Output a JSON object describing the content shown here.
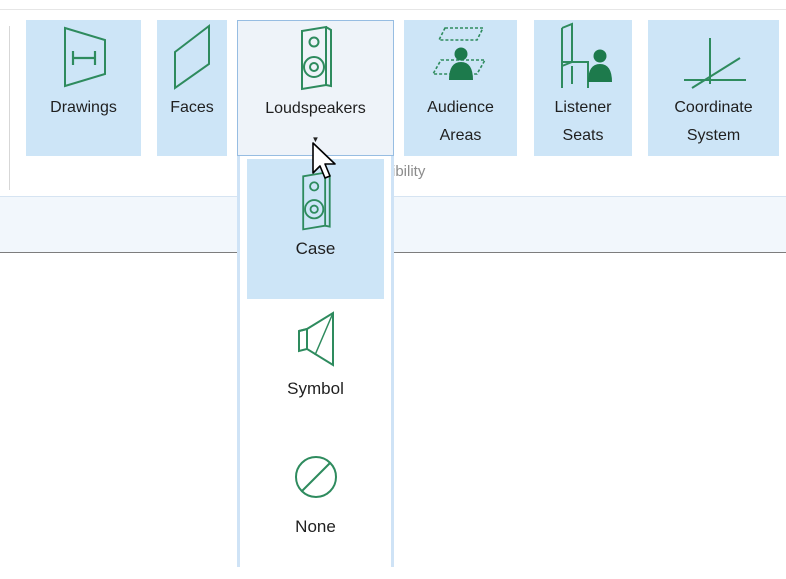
{
  "ribbon": {
    "group_label": "ibility",
    "buttons": [
      {
        "label": "Drawings",
        "icon": "drawing-dimension-icon"
      },
      {
        "label": "Faces",
        "icon": "face-plane-icon"
      },
      {
        "label": "Loudspeakers",
        "icon": "loudspeaker-case-icon",
        "has_dropdown": true,
        "state": "open"
      },
      {
        "label": "Audience\nAreas",
        "icon": "audience-area-icon"
      },
      {
        "label": "Listener\nSeats",
        "icon": "listener-seat-icon"
      },
      {
        "label": "Coordinate\nSystem",
        "icon": "coordinate-system-icon"
      }
    ]
  },
  "dropdown": {
    "items": [
      {
        "label": "Case",
        "icon": "loudspeaker-case-icon",
        "selected": true
      },
      {
        "label": "Symbol",
        "icon": "loudspeaker-symbol-icon",
        "selected": false
      },
      {
        "label": "None",
        "icon": "none-circle-icon",
        "selected": false
      }
    ]
  },
  "colors": {
    "button_bg": "#cde5f7",
    "active_border": "#97bde2",
    "icon_green": "#2e8b5e",
    "icon_green_fill": "#1d7a4c"
  }
}
